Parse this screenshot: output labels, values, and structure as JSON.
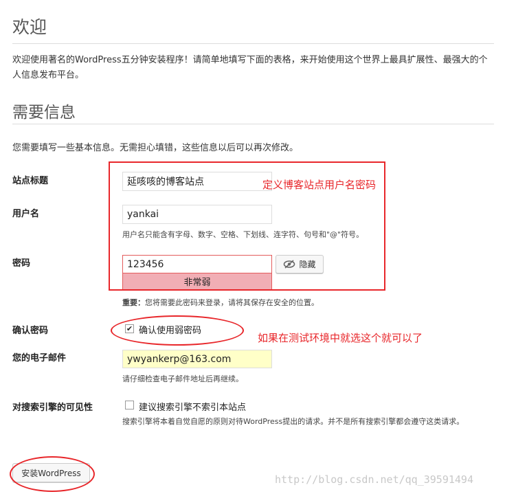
{
  "heading_welcome": "欢迎",
  "intro_text": "欢迎使用著名的WordPress五分钟安装程序！请简单地填写下面的表格，来开始使用这个世界上最具扩展性、最强大的个人信息发布平台。",
  "heading_required": "需要信息",
  "description": "您需要填写一些基本信息。无需担心填错，这些信息以后可以再次修改。",
  "form": {
    "site_title": {
      "label": "站点标题",
      "value": "延咳咳的博客站点"
    },
    "username": {
      "label": "用户名",
      "value": "yankai",
      "hint": "用户名只能含有字母、数字、空格、下划线、连字符、句号和\"@\"符号。"
    },
    "password": {
      "label": "密码",
      "value": "123456",
      "strength": "非常弱",
      "hide_label": "隐藏",
      "important_label": "重要：",
      "important_text": "您将需要此密码来登录，请将其保存在安全的位置。"
    },
    "confirm_password": {
      "label": "确认密码",
      "checkbox_label": "确认使用弱密码",
      "checked": true
    },
    "email": {
      "label": "您的电子邮件",
      "value": "ywyankerp@163.com",
      "hint": "请仔细检查电子邮件地址后再继续。"
    },
    "search_visibility": {
      "label": "对搜索引擎的可见性",
      "checkbox_label": "建议搜索引擎不索引本站点",
      "checked": false,
      "hint": "搜索引擎将本着自觉自愿的原则对待WordPress提出的请求。并不是所有搜索引擎都会遵守这类请求。"
    },
    "install_button": "安装WordPress"
  },
  "annotations": {
    "note_site_info": "定义博客站点用户名密码",
    "note_test_env": "如果在测试环境中就选这个就可以了"
  },
  "watermark": "http://blog.csdn.net/qq_39591494",
  "colors": {
    "annotation_red": "#e8262a",
    "strength_bg": "#f1aeb5",
    "password_border": "#e35b5b",
    "email_bg": "#ffffc8"
  },
  "icons": {
    "hide_password": "eye-slash-icon",
    "checkbox_checked": "checkmark-icon"
  }
}
